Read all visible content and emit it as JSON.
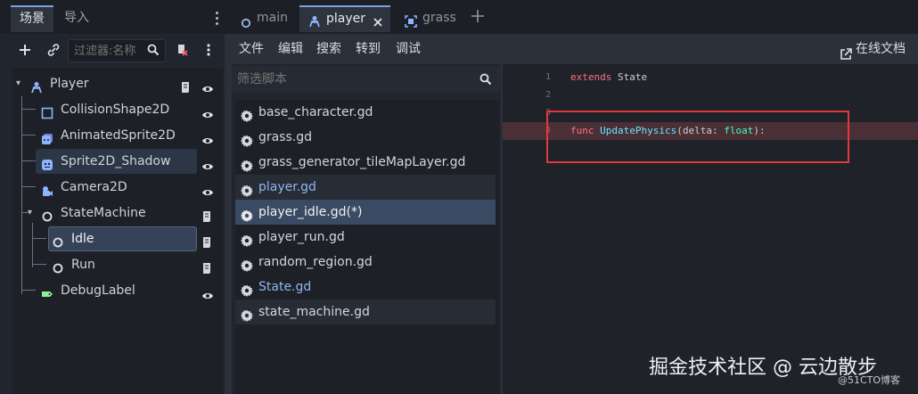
{
  "left_dock": {
    "tabs": [
      {
        "label": "场景",
        "active": true
      },
      {
        "label": "导入",
        "active": false
      }
    ],
    "filter_placeholder": "过滤器:名称"
  },
  "scene_tree": [
    {
      "label": "Player",
      "icon": "player-icon",
      "expanded": true
    },
    {
      "label": "CollisionShape2D",
      "icon": "collision-shape-icon"
    },
    {
      "label": "AnimatedSprite2D",
      "icon": "animated-sprite-icon"
    },
    {
      "label": "Sprite2D_Shadow",
      "icon": "sprite-icon"
    },
    {
      "label": "Camera2D",
      "icon": "camera-icon"
    },
    {
      "label": "StateMachine",
      "icon": "node-icon",
      "expanded": true
    },
    {
      "label": "Idle",
      "icon": "node-icon",
      "selected": true
    },
    {
      "label": "Run",
      "icon": "node-icon"
    },
    {
      "label": "DebugLabel",
      "icon": "label-icon"
    }
  ],
  "main_tabs": [
    {
      "label": "main",
      "icon": "node-icon",
      "active": false
    },
    {
      "label": "player",
      "icon": "player-icon",
      "active": true
    },
    {
      "label": "grass",
      "icon": "tilemap-icon",
      "active": false
    }
  ],
  "menu": [
    "文件",
    "编辑",
    "搜索",
    "转到",
    "调试"
  ],
  "online_docs": "在线文档",
  "script_filter_placeholder": "筛选脚本",
  "scripts": [
    "base_character.gd",
    "grass.gd",
    "grass_generator_tileMapLayer.gd",
    "player.gd",
    "player_idle.gd(*)",
    "player_run.gd",
    "random_region.gd",
    "State.gd",
    "state_machine.gd"
  ],
  "code": {
    "line_numbers": [
      "1",
      "2",
      "3",
      "4"
    ],
    "line1": {
      "kw": "extends",
      "rest": " State"
    },
    "line4": {
      "kw": "func",
      "fn": "UpdatePhysics",
      "p1": "(delta: ",
      "ty": "float",
      "p2": "):"
    }
  },
  "watermark": "掘金技术社区 @ 云边散步",
  "watermark_sub": "@51CTO博客",
  "colors": {
    "accent": "#7aa2de",
    "error_box": "#e03a3a",
    "keyword": "#ff7085",
    "function": "#66e6ff",
    "type": "#42ffc2"
  }
}
